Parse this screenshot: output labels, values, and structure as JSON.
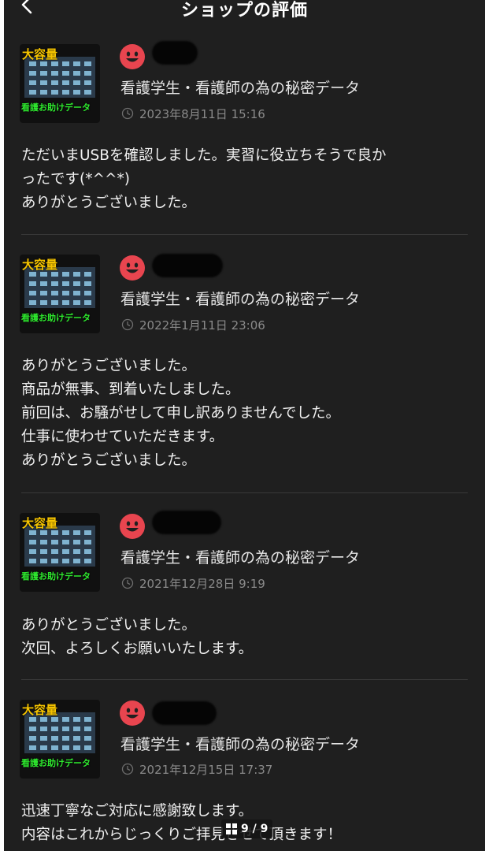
{
  "header": {
    "title": "ショップの評価"
  },
  "reviews": [
    {
      "thumb_top": "大容量",
      "thumb_bottom": "看護お助けデータ",
      "shop_name": "看護学生・看護師の為の秘密データ",
      "date": "2023年8月11日 15:16",
      "lines": [
        "ただいまUSBを確認しました。実習に役立ちそうで良か",
        "ったです(*^^*)",
        "ありがとうございました。"
      ]
    },
    {
      "thumb_top": "大容量",
      "thumb_bottom": "看護お助けデータ",
      "shop_name": "看護学生・看護師の為の秘密データ",
      "date": "2022年1月11日 23:06",
      "lines": [
        "ありがとうございました。",
        "商品が無事、到着いたしました。",
        "前回は、お騒がせして申し訳ありませんでした。",
        "仕事に使わせていただきます。",
        "ありがとうございました。"
      ]
    },
    {
      "thumb_top": "大容量",
      "thumb_bottom": "看護お助けデータ",
      "shop_name": "看護学生・看護師の為の秘密データ",
      "date": "2021年12月28日 9:19",
      "lines": [
        "ありがとうございました。",
        "次回、よろしくお願いいたします。"
      ]
    },
    {
      "thumb_top": "大容量",
      "thumb_bottom": "看護お助けデータ",
      "shop_name": "看護学生・看護師の為の秘密データ",
      "date": "2021年12月15日 17:37",
      "lines": [
        "迅速丁寧なご対応に感謝致します。",
        "内容はこれからじっくりご拝見させて頂きます！"
      ]
    }
  ],
  "pager": {
    "label": "9 / 9"
  },
  "colors": {
    "background": "#1f1f1f",
    "smiley": "#e8454f",
    "text": "#f0f0f0",
    "muted": "#8a8a8a"
  },
  "icons": [
    "back-arrow-icon",
    "smiley-icon",
    "clock-icon",
    "grid-icon"
  ]
}
